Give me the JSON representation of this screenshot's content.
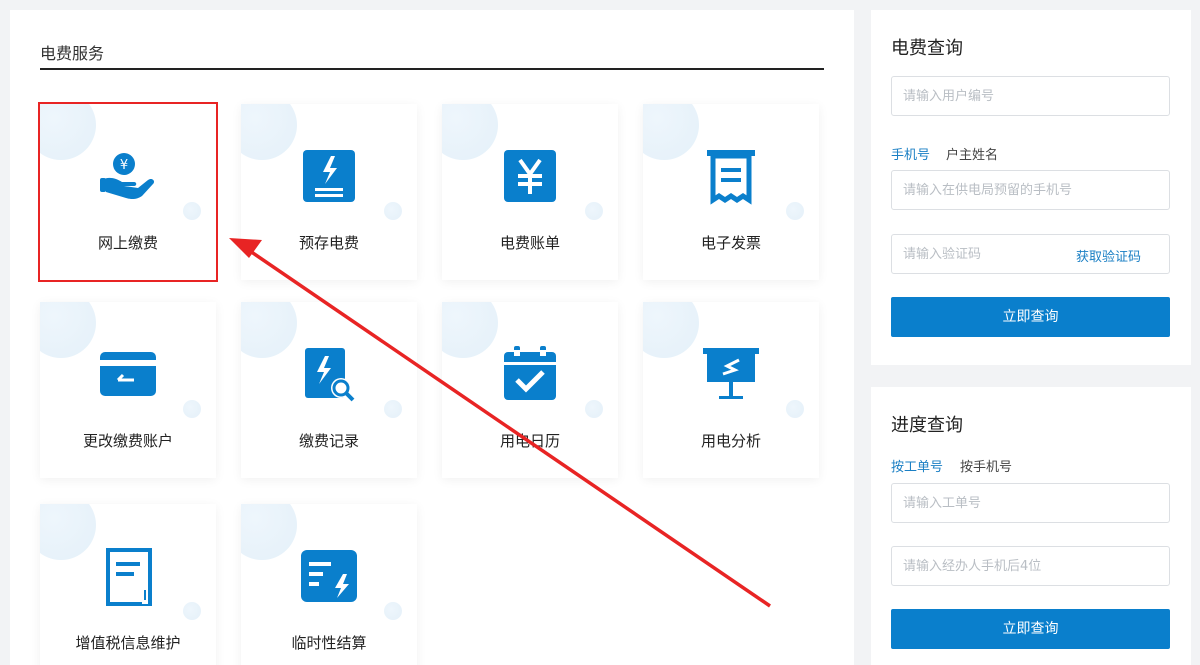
{
  "services": {
    "title": "电费服务",
    "tiles": [
      {
        "label": "网上缴费",
        "icon": "hand-coin-icon"
      },
      {
        "label": "预存电费",
        "icon": "electricity-deposit-icon"
      },
      {
        "label": "电费账单",
        "icon": "yuan-bill-icon"
      },
      {
        "label": "电子发票",
        "icon": "receipt-icon"
      },
      {
        "label": "更改缴费账户",
        "icon": "card-change-icon"
      },
      {
        "label": "缴费记录",
        "icon": "record-search-icon"
      },
      {
        "label": "用电日历",
        "icon": "calendar-check-icon"
      },
      {
        "label": "用电分析",
        "icon": "chart-board-icon"
      },
      {
        "label": "增值税信息维护",
        "icon": "document-icon"
      },
      {
        "label": "临时性结算",
        "icon": "settlement-icon"
      }
    ]
  },
  "fee_query": {
    "title": "电费查询",
    "user_id_placeholder": "请输入用户编号",
    "tab_phone": "手机号",
    "tab_name": "户主姓名",
    "phone_placeholder": "请输入在供电局预留的手机号",
    "code_placeholder": "请输入验证码",
    "get_code": "获取验证码",
    "submit": "立即查询"
  },
  "progress_query": {
    "title": "进度查询",
    "tab_order": "按工单号",
    "tab_phone": "按手机号",
    "order_placeholder": "请输入工单号",
    "agent_phone_placeholder": "请输入经办人手机后4位",
    "submit": "立即查询"
  },
  "colors": {
    "icon_blue": "#0a7fcc",
    "accent_link": "#1a7fc4",
    "highlight_red": "#e82424"
  }
}
